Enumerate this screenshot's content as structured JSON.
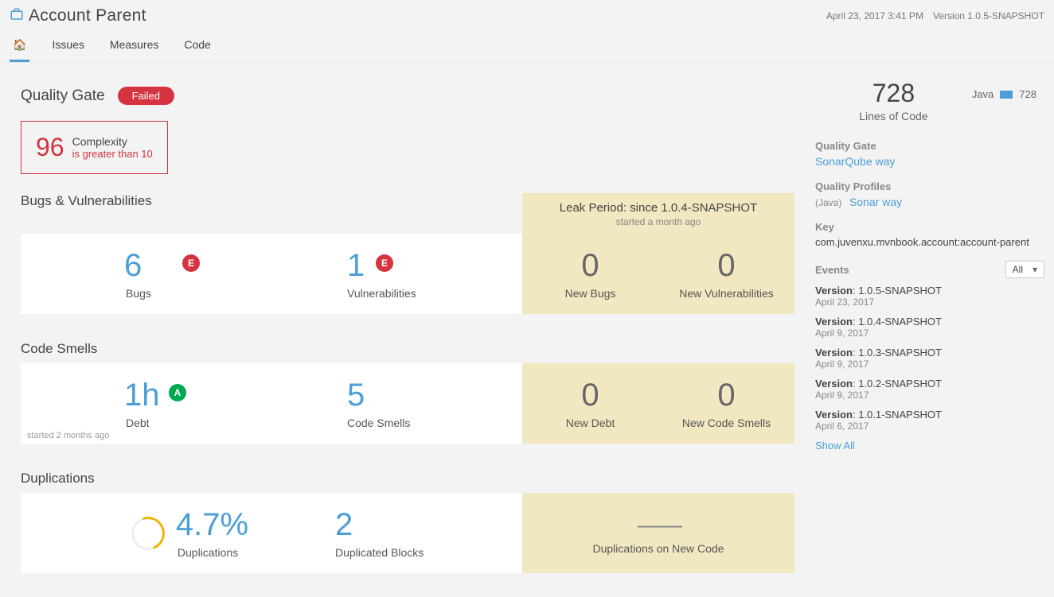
{
  "header": {
    "title": "Account Parent",
    "date": "April 23, 2017 3:41 PM",
    "version_label": "Version 1.0.5-SNAPSHOT"
  },
  "tabs": {
    "issues": "Issues",
    "measures": "Measures",
    "code": "Code"
  },
  "quality_gate": {
    "title": "Quality Gate",
    "status": "Failed",
    "value": "96",
    "metric": "Complexity",
    "condition": "is greater than 10"
  },
  "leak": {
    "title": "Leak Period: since 1.0.4-SNAPSHOT",
    "sub": "started a month ago"
  },
  "bugs": {
    "section": "Bugs & Vulnerabilities",
    "bugs_val": "6",
    "bugs_label": "Bugs",
    "bugs_rating": "E",
    "vuln_val": "1",
    "vuln_label": "Vulnerabilities",
    "vuln_rating": "E",
    "new_bugs_val": "0",
    "new_bugs_label": "New Bugs",
    "new_vuln_val": "0",
    "new_vuln_label": "New Vulnerabilities"
  },
  "smells": {
    "section": "Code Smells",
    "debt_val": "1h",
    "debt_label": "Debt",
    "debt_rating": "A",
    "smells_val": "5",
    "smells_label": "Code Smells",
    "new_debt_val": "0",
    "new_debt_label": "New Debt",
    "new_smells_val": "0",
    "new_smells_label": "New Code Smells",
    "started": "started 2 months ago"
  },
  "dup": {
    "section": "Duplications",
    "dup_val": "4.7%",
    "dup_label": "Duplications",
    "blocks_val": "2",
    "blocks_label": "Duplicated Blocks",
    "new_dup_label": "Duplications on New Code",
    "dash": "——"
  },
  "side": {
    "loc_val": "728",
    "loc_label": "Lines of Code",
    "lang": "Java",
    "lang_val": "728",
    "qg_label": "Quality Gate",
    "qg_link": "SonarQube way",
    "qp_label": "Quality Profiles",
    "qp_lang": "(Java)",
    "qp_link": "Sonar way",
    "key_label": "Key",
    "key_val": "com.juvenxu.mvnbook.account:account-parent",
    "events_label": "Events",
    "events_filter": "All",
    "events": [
      {
        "ver": "1.0.5-SNAPSHOT",
        "date": "April 23, 2017"
      },
      {
        "ver": "1.0.4-SNAPSHOT",
        "date": "April 9, 2017"
      },
      {
        "ver": "1.0.3-SNAPSHOT",
        "date": "April 9, 2017"
      },
      {
        "ver": "1.0.2-SNAPSHOT",
        "date": "April 9, 2017"
      },
      {
        "ver": "1.0.1-SNAPSHOT",
        "date": "April 6, 2017"
      }
    ],
    "version_prefix": "Version",
    "show_all": "Show All"
  }
}
